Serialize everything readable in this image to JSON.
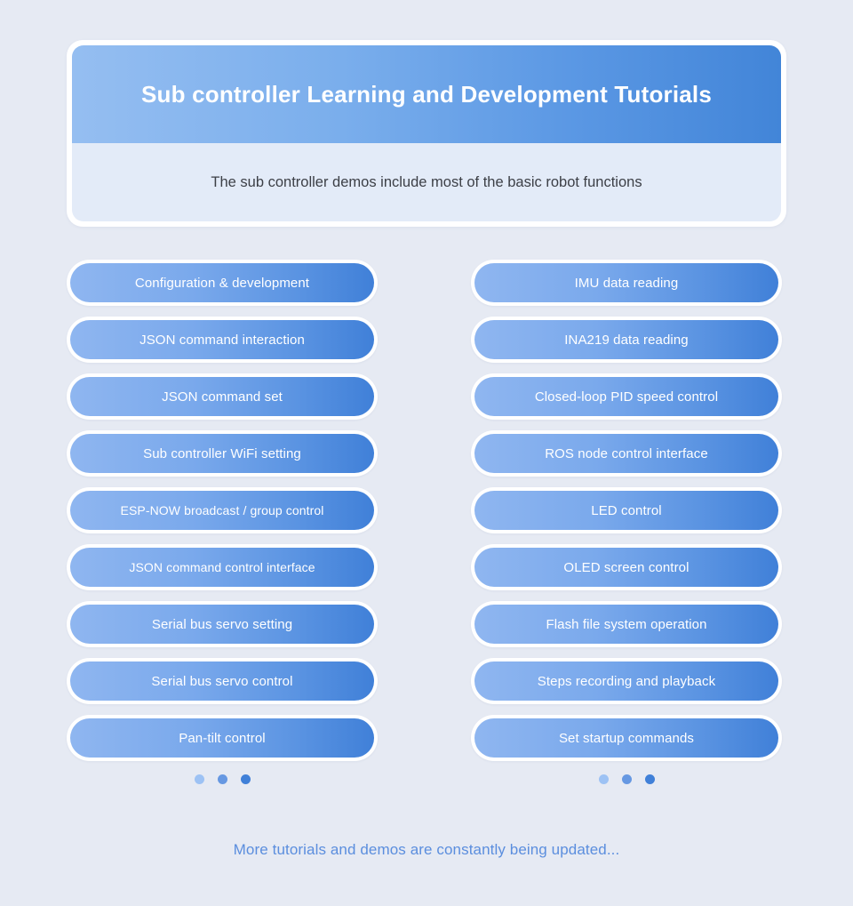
{
  "header": {
    "title": "Sub controller Learning and Development Tutorials",
    "subtitle": "The sub controller demos include most of the basic robot functions",
    "banner_gradient_start": "#95bef1",
    "banner_gradient_end": "#4285d8",
    "subtitle_panel_color": "#e3ebf8"
  },
  "page": {
    "background_color": "#e6eaf3",
    "accent_color": "#4080d8"
  },
  "columns": [
    {
      "name": "left-column",
      "items": [
        {
          "label": "Configuration & development"
        },
        {
          "label": "JSON command interaction"
        },
        {
          "label": "JSON command set"
        },
        {
          "label": "Sub controller WiFi setting"
        },
        {
          "label": "ESP-NOW broadcast / group control"
        },
        {
          "label": "JSON command control interface"
        },
        {
          "label": "Serial bus servo setting"
        },
        {
          "label": "Serial bus servo control"
        },
        {
          "label": "Pan-tilt control"
        }
      ],
      "dots": [
        {
          "color": "#9dc2f4"
        },
        {
          "color": "#6698e2"
        },
        {
          "color": "#4080d8"
        }
      ]
    },
    {
      "name": "right-column",
      "items": [
        {
          "label": "IMU data reading"
        },
        {
          "label": "INA219 data reading"
        },
        {
          "label": "Closed-loop PID speed control"
        },
        {
          "label": "ROS node control interface"
        },
        {
          "label": "LED control"
        },
        {
          "label": "OLED screen control"
        },
        {
          "label": "Flash file system operation"
        },
        {
          "label": "Steps recording and playback"
        },
        {
          "label": "Set startup commands"
        }
      ],
      "dots": [
        {
          "color": "#9dc2f4"
        },
        {
          "color": "#6698e2"
        },
        {
          "color": "#4080d8"
        }
      ]
    }
  ],
  "footer": {
    "text": "More tutorials and demos are constantly being updated...",
    "color": "#5b8ede"
  }
}
